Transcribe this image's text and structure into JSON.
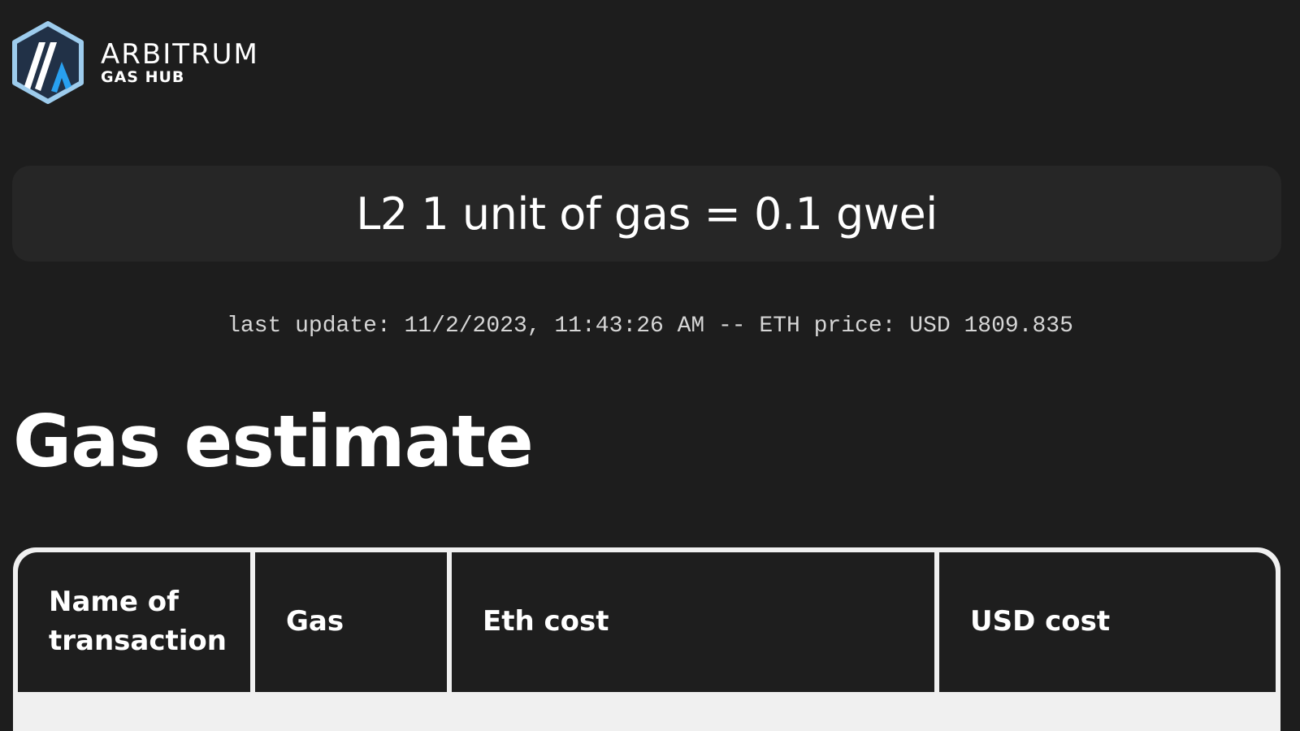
{
  "logo": {
    "title": "ARBITRUM",
    "subtitle": "GAS HUB",
    "icon": "arbitrum-logo-icon",
    "colors": {
      "hex_outline": "#9dcced",
      "hex_fill": "#213147",
      "stripe_white": "#ffffff",
      "stripe_blue": "#28a0f0"
    }
  },
  "banner": {
    "text": "L2 1 unit of gas = 0.1 gwei"
  },
  "status": {
    "text": "last update: 11/2/2023, 11:43:26 AM -- ETH price: USD 1809.835"
  },
  "main": {
    "heading": "Gas estimate"
  },
  "table": {
    "columns": [
      "Name of transaction",
      "Gas",
      "Eth cost",
      "USD cost"
    ],
    "rows": []
  },
  "colors": {
    "background": "#1d1d1d",
    "banner_bg": "#262626",
    "table_header_bg": "#1e1e1e",
    "table_body_bg": "#f0f0f0",
    "text": "#ffffff"
  }
}
